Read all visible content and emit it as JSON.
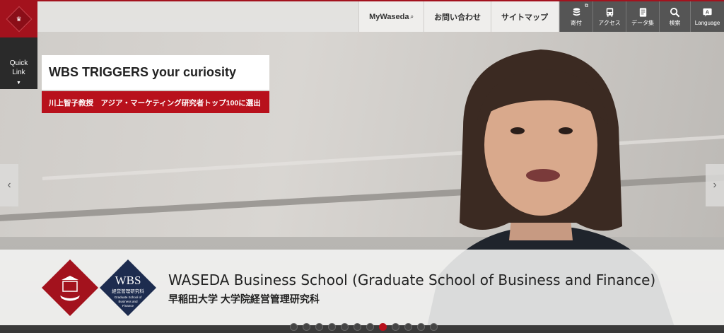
{
  "header": {
    "logo_glyph": "♛",
    "quick_link": {
      "line1": "Quick",
      "line2": "Link",
      "caret": "▼"
    },
    "nav_links": [
      {
        "label": "MyWaseda",
        "ext": "⌕"
      },
      {
        "label": "お問い合わせ"
      },
      {
        "label": "サイトマップ"
      }
    ],
    "icon_links": [
      {
        "icon": "donation-coins-icon",
        "label": "寄付",
        "ext": "⧉"
      },
      {
        "icon": "bus-icon",
        "label": "アクセス"
      },
      {
        "icon": "data-book-icon",
        "label": "データ集"
      },
      {
        "icon": "search-icon",
        "label": "検索"
      },
      {
        "icon": "language-icon",
        "label": "Language"
      }
    ]
  },
  "hero": {
    "headline": "WBS TRIGGERS your curiosity",
    "subline": "川上智子教授　アジア・マーケティング研究者トップ100に選出",
    "prev_glyph": "‹",
    "next_glyph": "›"
  },
  "banner": {
    "wbs_text": "WBS",
    "wbs_jp": "経営管理研究科",
    "wbs_en1": "Graduate School of",
    "wbs_en2": "Business and",
    "wbs_en3": "Finance",
    "title": "WASEDA Business School (Graduate School of Business and Finance)",
    "subtitle": "早稲田大学 大学院経営管理研究科"
  },
  "carousel": {
    "total_slides": 12,
    "active_index": 7
  },
  "colors": {
    "brand_red": "#a3121d",
    "dark": "#2a2a2a",
    "navy": "#1d2c4f"
  }
}
